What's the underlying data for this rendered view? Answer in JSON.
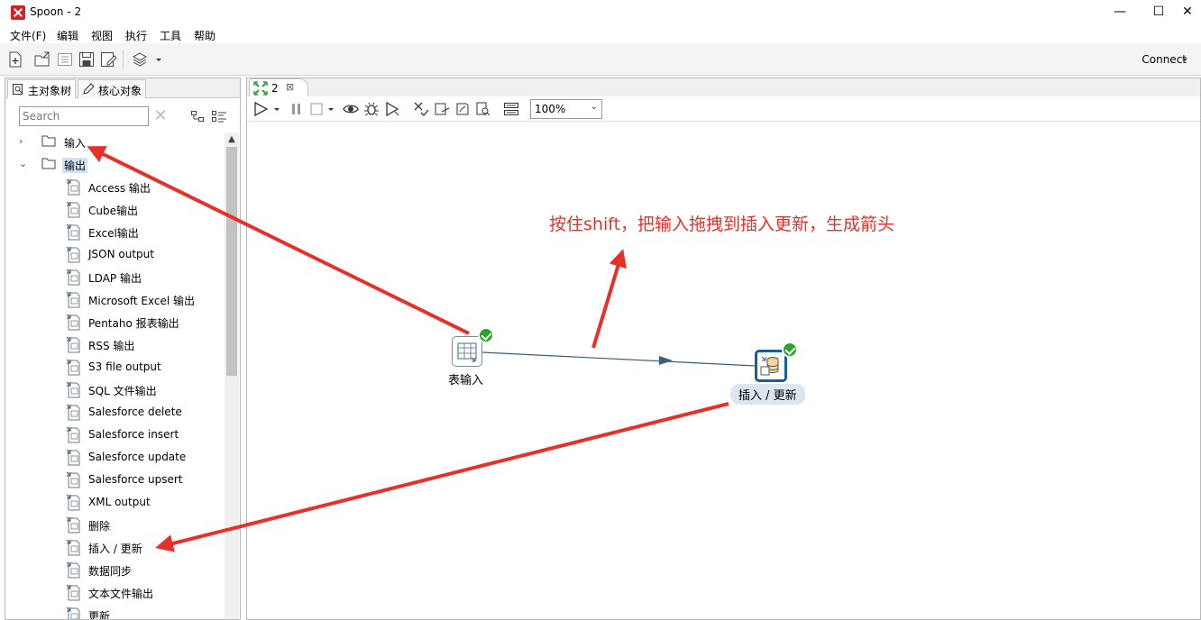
{
  "window": {
    "title": "Spoon - 2",
    "minimize": "—",
    "maximize": "☐",
    "close": "✕"
  },
  "menu": [
    "文件(F)",
    "编辑",
    "视图",
    "执行",
    "工具",
    "帮助"
  ],
  "toolbar": {
    "connect_label": "Connect",
    "icons": [
      "new-file-icon",
      "open-icon",
      "explore-icon",
      "save-icon",
      "save-as-icon",
      "layers-icon"
    ]
  },
  "left_panel": {
    "tabs": [
      {
        "label": "主对象树",
        "icon": "tree-icon"
      },
      {
        "label": "核心对象",
        "icon": "pencil-icon"
      }
    ],
    "search": {
      "placeholder": "Search",
      "value": "Search"
    },
    "tree": [
      {
        "label": "输入",
        "type": "folder",
        "expanded": false
      },
      {
        "label": "输出",
        "type": "folder",
        "expanded": true,
        "selected": true
      },
      {
        "label": "Access 输出",
        "type": "step",
        "icon": "access-icon"
      },
      {
        "label": "Cube输出",
        "type": "step",
        "icon": "cube-icon"
      },
      {
        "label": "Excel输出",
        "type": "step",
        "icon": "excel-icon"
      },
      {
        "label": "JSON output",
        "type": "step",
        "icon": "json-icon"
      },
      {
        "label": "LDAP 输出",
        "type": "step",
        "icon": "ldap-icon"
      },
      {
        "label": "Microsoft Excel 输出",
        "type": "step",
        "icon": "excel-icon"
      },
      {
        "label": "Pentaho 报表输出",
        "type": "step",
        "icon": "report-icon"
      },
      {
        "label": "RSS 输出",
        "type": "step",
        "icon": "rss-icon"
      },
      {
        "label": "S3 file output",
        "type": "step",
        "icon": "s3-icon"
      },
      {
        "label": "SQL 文件输出",
        "type": "step",
        "icon": "sql-icon"
      },
      {
        "label": "Salesforce delete",
        "type": "step",
        "icon": "salesforce-delete-icon"
      },
      {
        "label": "Salesforce insert",
        "type": "step",
        "icon": "salesforce-insert-icon"
      },
      {
        "label": "Salesforce update",
        "type": "step",
        "icon": "salesforce-update-icon"
      },
      {
        "label": "Salesforce upsert",
        "type": "step",
        "icon": "salesforce-upsert-icon"
      },
      {
        "label": "XML output",
        "type": "step",
        "icon": "xml-icon"
      },
      {
        "label": "删除",
        "type": "step",
        "icon": "delete-icon"
      },
      {
        "label": "插入 / 更新",
        "type": "step",
        "icon": "insert-update-icon"
      },
      {
        "label": "数据同步",
        "type": "step",
        "icon": "sync-icon"
      },
      {
        "label": "文本文件输出",
        "type": "step",
        "icon": "text-file-icon"
      },
      {
        "label": "更新",
        "type": "step",
        "icon": "update-icon"
      }
    ]
  },
  "editor": {
    "tab_label": "2",
    "tab_close": "⊠",
    "zoom": "100%",
    "zoom_arrow": "⌄",
    "steps": [
      {
        "label": "表输入",
        "icon": "table-input-icon",
        "status": "ok"
      },
      {
        "label": "插入 / 更新",
        "icon": "insert-update-icon",
        "status": "ok",
        "selected": true
      }
    ],
    "annotation": "按住shift，把输入拖拽到插入更新，生成箭头"
  },
  "colors": {
    "annotation_red": "#e8302a",
    "hop_blue": "#3a5f7d",
    "selected_blue": "#1b5c9a",
    "check_green": "#2aa52a"
  }
}
